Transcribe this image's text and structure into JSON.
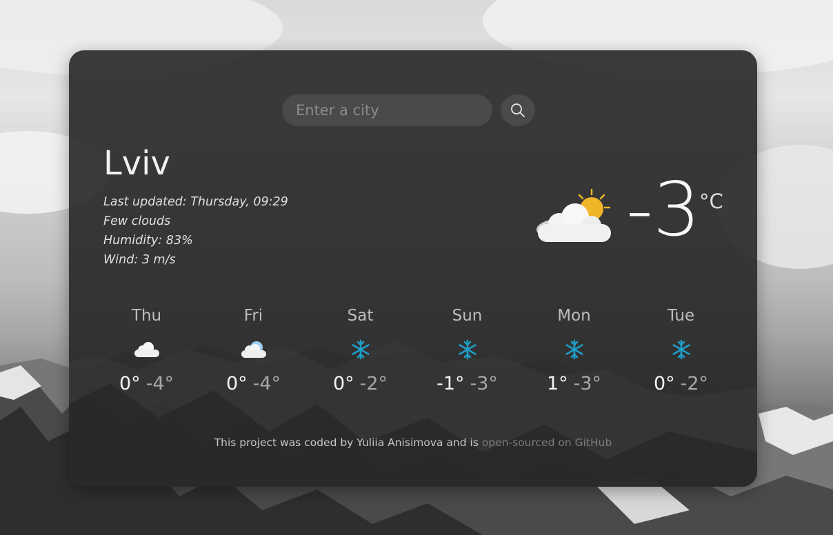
{
  "search": {
    "placeholder": "Enter a city",
    "icon": "search-icon"
  },
  "current": {
    "city": "Lviv",
    "last_updated": "Last updated: Thursday, 09:29",
    "description": "Few clouds",
    "humidity": "Humidity: 83%",
    "wind": "Wind: 3 m/s",
    "temperature": "-3",
    "unit": "°C",
    "icon": "sun-behind-cloud-icon"
  },
  "forecast": [
    {
      "day": "Thu",
      "max": "0°",
      "min": "-4°",
      "icon": "cloud-icon"
    },
    {
      "day": "Fri",
      "max": "0°",
      "min": "-4°",
      "icon": "cloud-icon"
    },
    {
      "day": "Sat",
      "max": "0°",
      "min": "-2°",
      "icon": "snowflake-icon"
    },
    {
      "day": "Sun",
      "max": "-1°",
      "min": "-3°",
      "icon": "snowflake-icon"
    },
    {
      "day": "Mon",
      "max": "1°",
      "min": "-3°",
      "icon": "snowflake-icon"
    },
    {
      "day": "Tue",
      "max": "0°",
      "min": "-2°",
      "icon": "snowflake-icon"
    }
  ],
  "footer": {
    "text": "This project was coded by Yuliia Anisimova and is",
    "link": "open-sourced on GitHub"
  },
  "colors": {
    "card": "#262626",
    "sun": "#f0b429",
    "snowflake": "#1e9fc8",
    "muted_link": "#7c7c7c"
  }
}
